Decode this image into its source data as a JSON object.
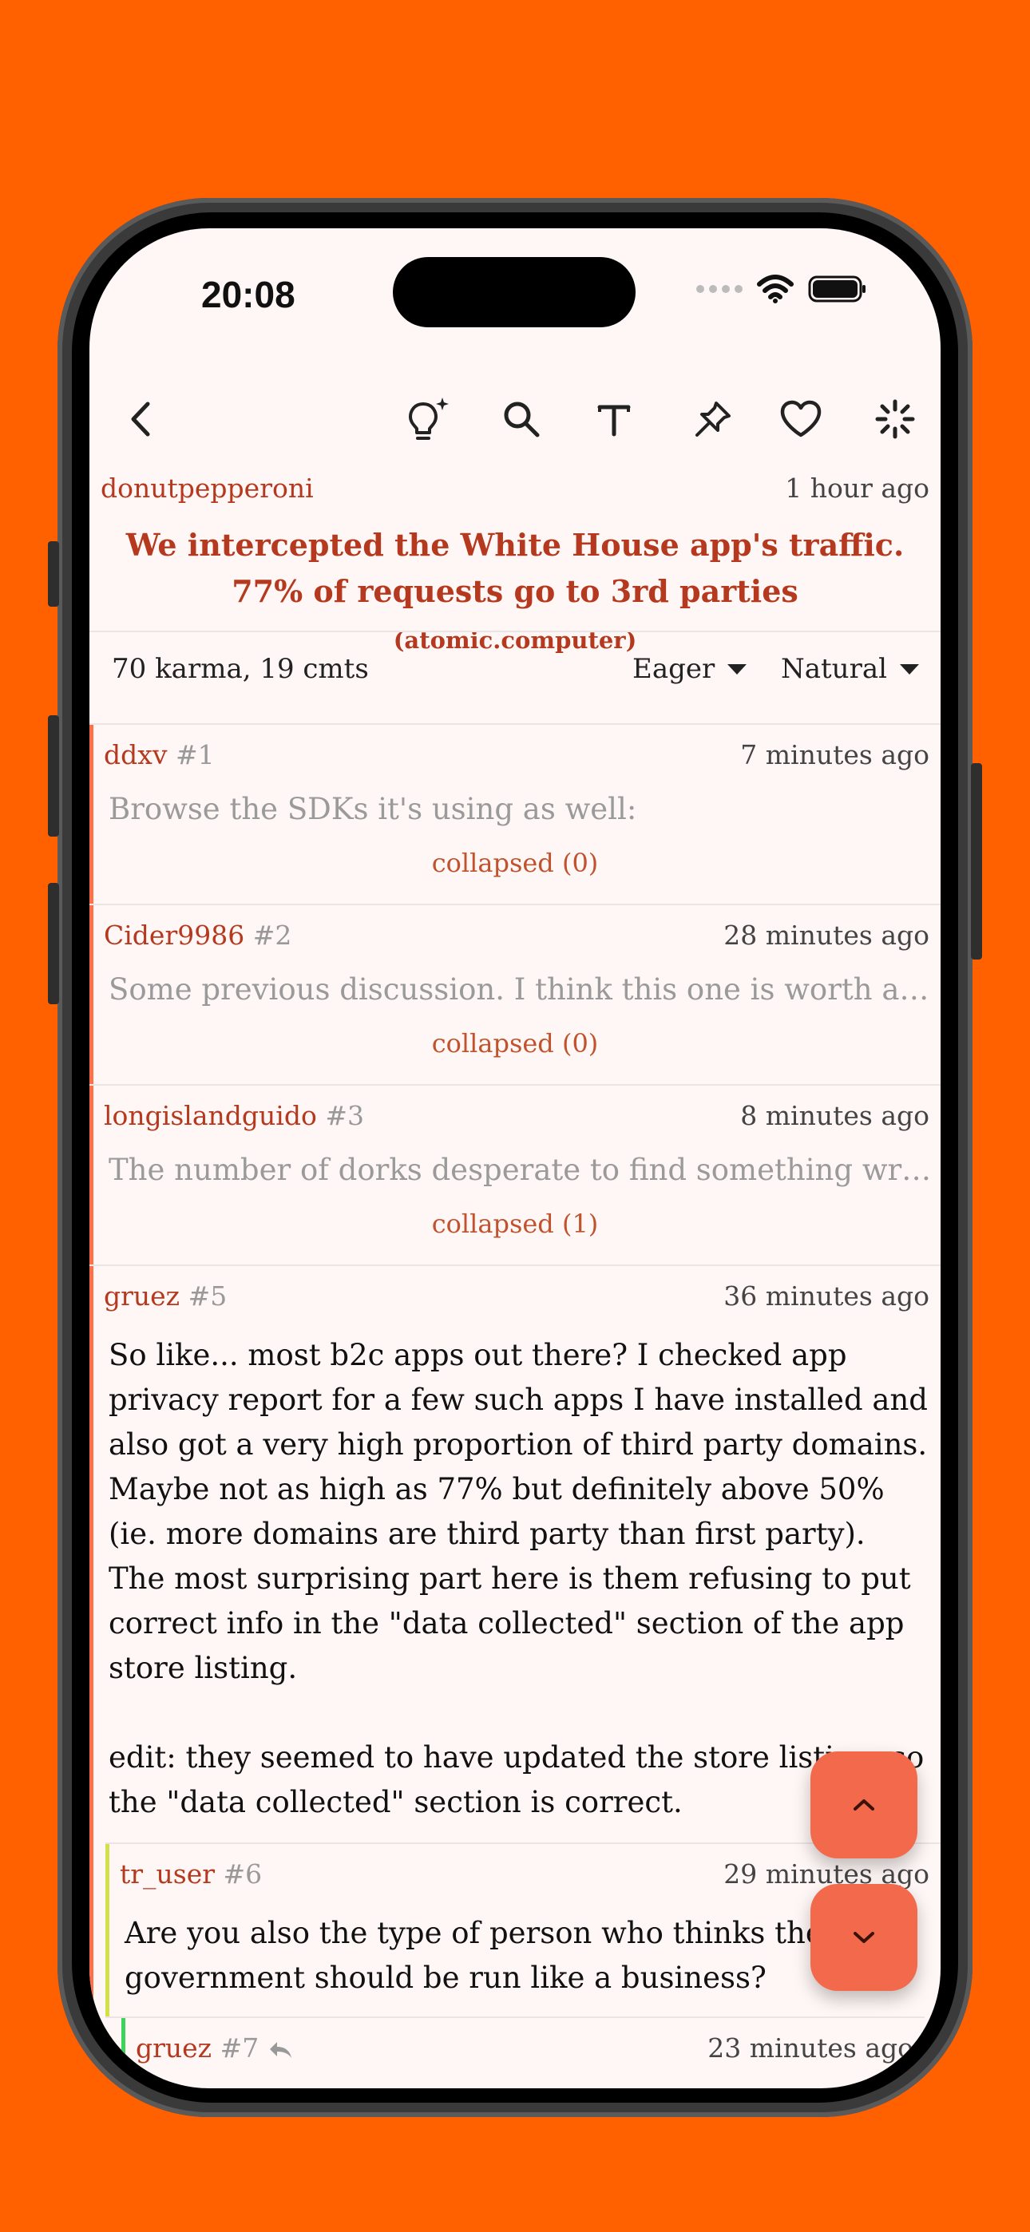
{
  "status_bar": {
    "time": "20:08"
  },
  "post": {
    "author": "donutpepperoni",
    "time_ago": "1 hour ago",
    "title": "We intercepted the White House app's traffic. 77% of requests go to 3rd parties",
    "domain": "(atomic.computer)"
  },
  "stats": {
    "summary": "70 karma, 19 cmts",
    "filter_label": "Eager",
    "sort_label": "Natural"
  },
  "comments": [
    {
      "author": "ddxv",
      "number": "#1",
      "time_ago": "7 minutes ago",
      "preview": "Browse the SDKs it's using as well:",
      "collapsed": "collapsed (0)"
    },
    {
      "author": "Cider9986",
      "number": "#2",
      "time_ago": "28 minutes ago",
      "preview": "Some previous discussion. I think this one is worth a …",
      "collapsed": "collapsed (0)"
    },
    {
      "author": "longislandguido",
      "number": "#3",
      "time_ago": "8 minutes ago",
      "preview": "The number of dorks desperate to find something wr…",
      "collapsed": "collapsed (1)"
    },
    {
      "author": "gruez",
      "number": "#5",
      "time_ago": "36 minutes ago",
      "body": "So like... most b2c apps out there? I checked app privacy report for a few such apps I have installed and also got a very high proportion of third party domains. Maybe not as high as 77% but definitely above 50% (ie. more domains are third party than first party). The most surprising part here is them refusing to put correct info in the \"data collected\" section of the app store listing.\n\nedit: they seemed to have updated the store listing, so the \"data collected\" section is correct."
    },
    {
      "author": "tr_user",
      "number": "#6",
      "time_ago": "29 minutes ago",
      "body": "Are you also the type of person who thinks the government should be run like a business?"
    },
    {
      "author": "gruez",
      "number": "#7",
      "time_ago": "23 minutes ago"
    }
  ],
  "colors": {
    "background": "#ff6000",
    "screen": "#fff7f5",
    "accent": "#b5391f",
    "fab": "#f26a4b",
    "thread_bar_top": "#ff6f4a",
    "thread_bar_level2": "#d4e04a",
    "thread_bar_level3": "#3dd35a"
  },
  "icons": {
    "back": "chevron-left-icon",
    "summarize": "lightbulb-sparkle-icon",
    "search": "search-icon",
    "text": "text-size-icon",
    "pin": "pin-icon",
    "favorite": "heart-icon",
    "loading": "spinner-icon",
    "scroll_up": "chevron-up-icon",
    "scroll_down": "chevron-down-icon",
    "reply": "reply-arrow-icon"
  }
}
